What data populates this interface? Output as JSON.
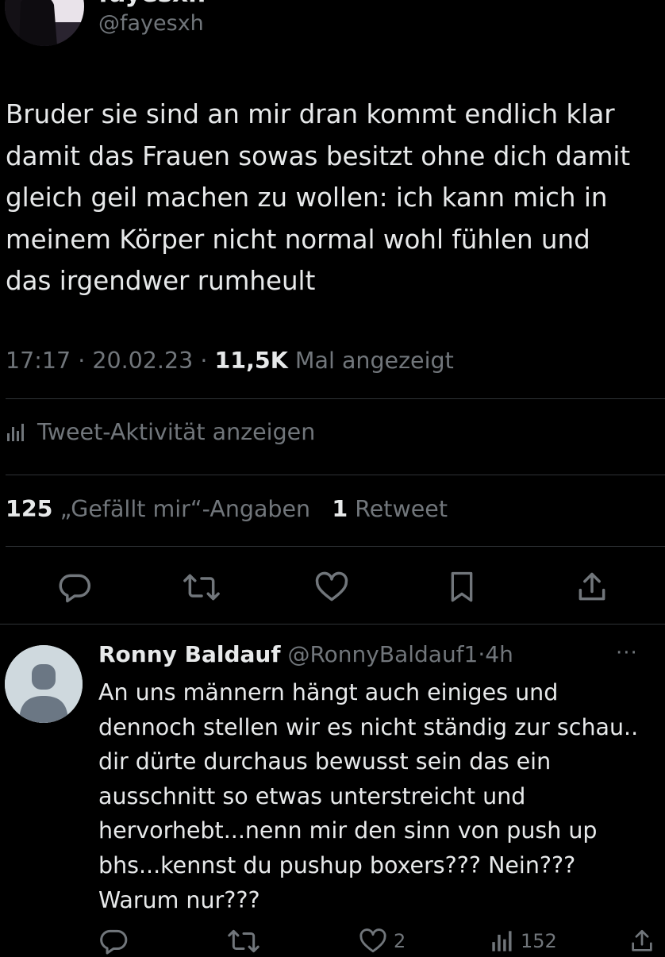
{
  "tweet": {
    "author_name": "fayesxh",
    "author_handle": "@fayesxh",
    "text_lines": [
      "Bruder sie sind an mir dran kommt endlich klar",
      "damit das Frauen sowas besitzt ohne dich damit",
      "gleich geil machen zu wollen: ich kann mich in",
      "meinem Körper nicht normal wohl fühlen und",
      "das irgendwer rumheult"
    ],
    "time": "17:17",
    "date": "20.02.23",
    "views_count": "11,5K",
    "views_label": "Mal angezeigt",
    "separator": "·",
    "activity_label": "Tweet-Aktivität anzeigen",
    "likes_count": "125",
    "likes_label": "„Gefällt mir“-Angaben",
    "retweets_count": "1",
    "retweets_label": "Retweet",
    "actions": [
      "reply-icon",
      "retweet-icon",
      "like-icon",
      "bookmark-icon",
      "share-icon"
    ]
  },
  "reply": {
    "author_name": "Ronny Baldauf",
    "author_handle": "@RonnyBaldauf1",
    "time_ago": "4h",
    "more": "···",
    "text_lines": [
      "An uns männern hängt auch einiges und",
      "dennoch stellen wir es nicht ständig zur schau..",
      "dir dürte durchaus bewusst sein das ein",
      "ausschnitt so etwas unterstreicht und",
      "hervorhebt...nenn mir den sinn von push up",
      "bhs...kennst du pushup boxers??? Nein???",
      "Warum nur???"
    ],
    "likes_count": "2",
    "views_count": "152"
  },
  "colors": {
    "background": "#000000",
    "text_primary": "#e7e9ea",
    "text_secondary": "#71767b",
    "divider": "#2f3336",
    "default_avatar_bg": "#cfd9de",
    "default_avatar_fg": "#6b7784"
  }
}
